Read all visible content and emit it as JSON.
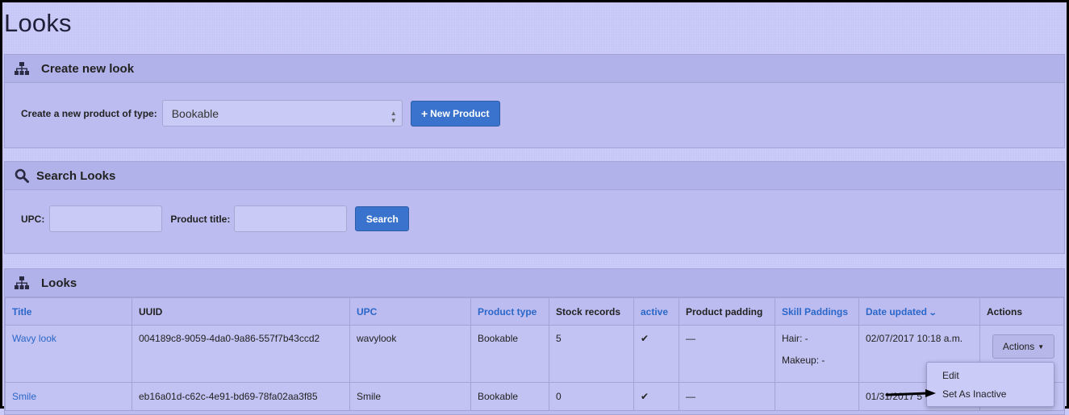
{
  "page": {
    "title": "Looks"
  },
  "create_panel": {
    "heading": "Create new look",
    "type_label": "Create a new product of type:",
    "selected_type": "Bookable",
    "new_button": "New Product"
  },
  "search_panel": {
    "heading": "Search Looks",
    "upc_label": "UPC:",
    "upc_value": "",
    "title_label": "Product title:",
    "title_value": "",
    "search_button": "Search"
  },
  "looks_panel": {
    "heading": "Looks",
    "columns": [
      "Title",
      "UUID",
      "UPC",
      "Product type",
      "Stock records",
      "active",
      "Product padding",
      "Skill Paddings",
      "Date updated",
      "Actions"
    ],
    "rows": [
      {
        "title": "Wavy look",
        "uuid": "004189c8-9059-4da0-9a86-557f7b43ccd2",
        "upc": "wavylook",
        "product_type": "Bookable",
        "stock_records": "5",
        "active": "✔",
        "product_padding": "—",
        "skill_hair": "Hair: -",
        "skill_makeup": "Makeup: -",
        "date_updated": "02/07/2017 10:18 a.m.",
        "actions_button": "Actions"
      },
      {
        "title": "Smile",
        "uuid": "eb16a01d-c62c-4e91-bd69-78fa02aa3f85",
        "upc": "Smile",
        "product_type": "Bookable",
        "stock_records": "0",
        "active": "✔",
        "product_padding": "—",
        "skill_hair": "",
        "skill_makeup": "",
        "date_updated": "01/31/2017 5"
      }
    ],
    "actions_menu": [
      "Edit",
      "Set As Inactive"
    ]
  },
  "colors": {
    "accent": "#3a73cd",
    "link": "#2a67c8",
    "background": "#c6c6f7"
  }
}
